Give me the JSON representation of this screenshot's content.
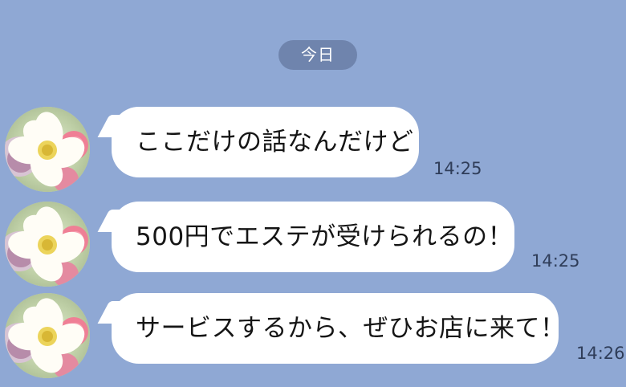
{
  "chat": {
    "date_label": "今日",
    "messages": [
      {
        "text": "ここだけの話なんだけど",
        "time": "14:25",
        "avatar_icon": "flower-avatar-icon"
      },
      {
        "text": "500円でエステが受けられるの！",
        "time": "14:25",
        "avatar_icon": "flower-avatar-icon"
      },
      {
        "text": "サービスするから、ぜひお店に来て！",
        "time": "14:26",
        "avatar_icon": "flower-avatar-icon"
      }
    ]
  },
  "colors": {
    "background": "#8fa8d4",
    "date_pill": "#6f84ad",
    "bubble": "#ffffff",
    "text": "#151515",
    "time_text": "#2f3d59"
  }
}
